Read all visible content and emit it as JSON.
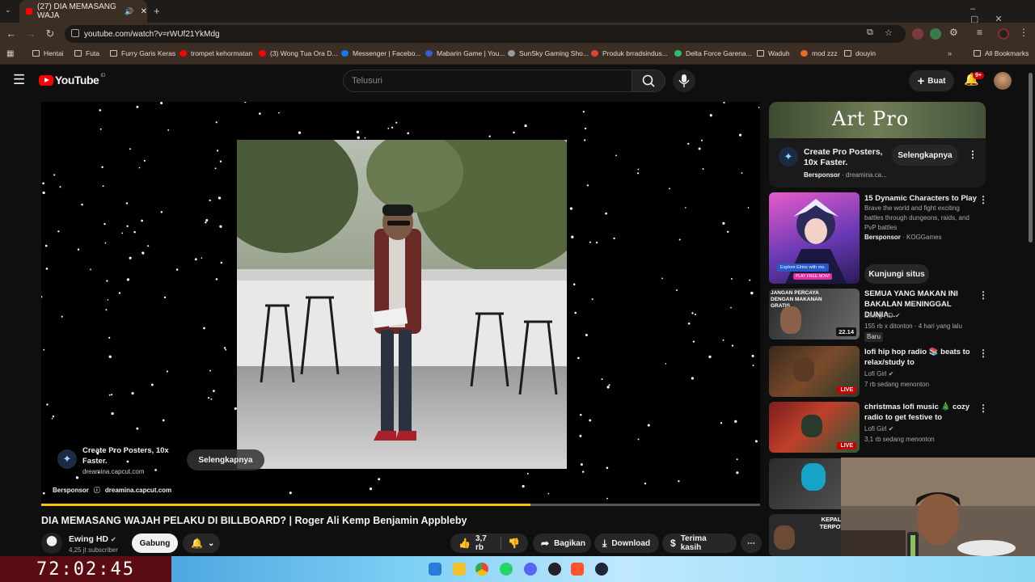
{
  "browser": {
    "tab_title": "(27) DIA MEMASANG WAJA",
    "url": "youtube.com/watch?v=rWUf21YkMdg",
    "bookmarks": [
      "Hentai",
      "Futa",
      "Furry Garis Keras",
      "trompet kehormatan",
      "(3) Wong Tua Ora D...",
      "Messenger | Facebo...",
      "Mabarin Game | You...",
      "SunSky Gaming Sho...",
      "Produk brradsindus...",
      "Delta Force Garena...",
      "Waduh",
      "mod zzz",
      "douyin"
    ],
    "all_bookmarks": "All Bookmarks"
  },
  "header": {
    "logo": "YouTube",
    "region": "ID",
    "search_placeholder": "Telusuri",
    "create_label": "Buat",
    "notif_count": "9+"
  },
  "player": {
    "ad_title": "Create Pro Posters, 10x Faster.",
    "ad_domain": "dreamina.capcut.com",
    "ad_cta": "Selengkapnya",
    "sponsor_label": "Bersponsor",
    "sponsor_domain": "dreamina.capcut.com",
    "progress": 0.68
  },
  "video": {
    "title": "DIA MEMASANG WAJAH PELAKU DI BILLBOARD? | Roger Ali Kemp Benjamin Appbleby",
    "channel": "Ewing HD",
    "subscribers": "4,25 jt subscriber",
    "join_label": "Gabung",
    "likes": "3,7 rb",
    "share_label": "Bagikan",
    "download_label": "Download",
    "thanks_label": "Terima kasih"
  },
  "sidebar": {
    "top_ad": {
      "banner_text": "Art Pro",
      "title": "Create Pro Posters, 10x Faster.",
      "sponsor": "Bersponsor",
      "domain": "dreamina.ca...",
      "cta": "Selengkapnya"
    },
    "game_ad": {
      "title": "15 Dynamic Characters to Play",
      "desc": "Brave the world and fight exciting battles through dungeons, raids, and PvP battles",
      "sponsor": "Bersponsor",
      "advertiser": "KOGGames",
      "cta": "Kunjungi situs",
      "thumb_caption": "Explore Elrios with me.",
      "thumb_cta": "PLAY FREE NOW!"
    },
    "videos": [
      {
        "title": "SEMUA YANG MAKAN INI BAKALAN MENINGGAL DUNIA...",
        "channel": "Ewing HD",
        "meta": "155 rb x ditonton · 4 hari yang lalu",
        "badge": "Baru",
        "duration": "22.14",
        "thumb_text": "JANGAN PERCAYA DENGAN MAKANAN GRATIS"
      },
      {
        "title": "lofi hip hop radio 📚 beats to relax/study to",
        "channel": "Lofi Girl",
        "meta": "7 rb sedang menonton",
        "live": "LIVE"
      },
      {
        "title": "christmas lofi music 🎄 cozy radio to get festive to",
        "channel": "Lofi Girl",
        "meta": "3,1 rb sedang menonton",
        "live": "LIVE"
      },
      {
        "thumb_text": "KEPALANYA TERPOTONG PAS"
      }
    ]
  },
  "overlay": {
    "timer": "72:02:45"
  },
  "colors": {
    "brand_red": "#ff0000",
    "progress": "#fbc200",
    "background": "#0f0f0f"
  }
}
